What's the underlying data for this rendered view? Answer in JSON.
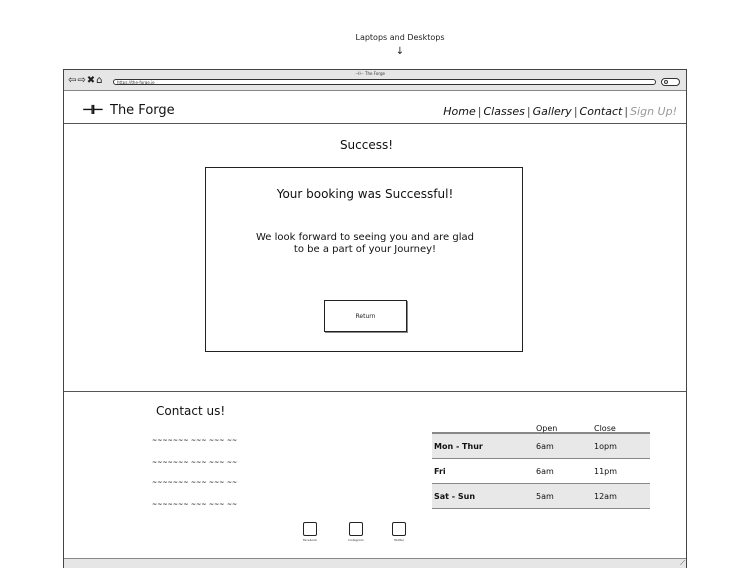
{
  "annotation": {
    "device_label": "Laptops and Desktops",
    "arrow": "↓"
  },
  "browser": {
    "tab_title": "The Forge",
    "nav_buttons": "⇦⇨✖⌂",
    "url": "https://the-forge.ie"
  },
  "header": {
    "logo_icon": "dumbbell-icon",
    "logo_glyph": "⊣⊢",
    "site_title": "The Forge",
    "nav": [
      {
        "label": "Home"
      },
      {
        "label": "Classes"
      },
      {
        "label": "Gallery"
      },
      {
        "label": "Contact"
      },
      {
        "label": "Sign Up!",
        "muted": true
      }
    ],
    "separator": "|"
  },
  "main": {
    "heading": "Success!",
    "card_title": "Your booking was Successful!",
    "card_message_line1": "We look forward to seeing you and are glad",
    "card_message_line2": "to be a part of your Journey!",
    "return_label": "Return"
  },
  "footer": {
    "contact_heading": "Contact us!",
    "contact_lines": [
      "~~~~~~~ ~~~ ~~~ ~~",
      "~~~~~~~ ~~~ ~~~ ~~",
      "~~~~~~~ ~~~ ~~~ ~~",
      "~~~~~~~ ~~~ ~~~ ~~"
    ],
    "hours": {
      "columns": [
        "",
        "Open",
        "Close"
      ],
      "rows": [
        {
          "day": "Mon - Thur",
          "open": "6am",
          "close": "1opm"
        },
        {
          "day": "Fri",
          "open": "6am",
          "close": "11pm"
        },
        {
          "day": "Sat - Sun",
          "open": "5am",
          "close": "12am"
        }
      ]
    },
    "social": [
      {
        "label": "Facebook",
        "icon": "facebook-icon"
      },
      {
        "label": "Instagram",
        "icon": "instagram-icon"
      },
      {
        "label": "Twitter",
        "icon": "twitter-icon"
      }
    ]
  },
  "colors": {
    "muted_link": "#999999",
    "table_shade": "#e8e8e8",
    "chrome": "#e6e6e6"
  }
}
